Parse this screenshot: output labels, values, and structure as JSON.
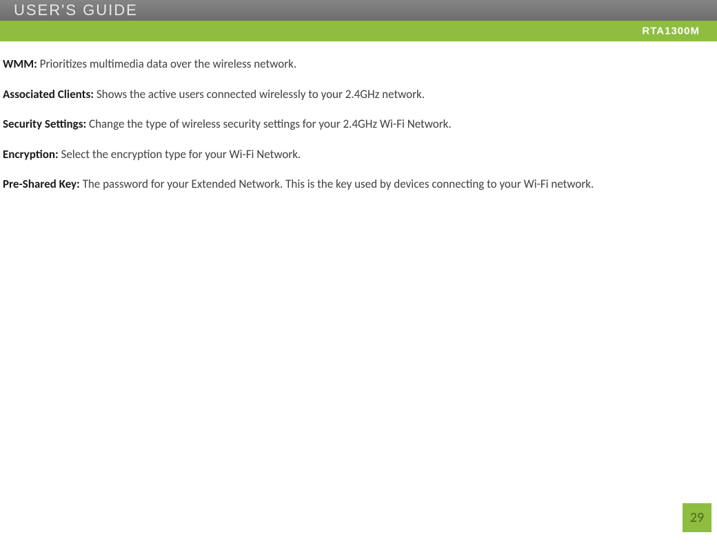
{
  "header": {
    "guide_title": "USER'S GUIDE",
    "model": "RTA1300M"
  },
  "definitions": [
    {
      "term": "WMM:",
      "description": " Prioritizes multimedia data over the wireless network."
    },
    {
      "term": "Associated Clients:",
      "description": " Shows the active users connected wirelessly to your 2.4GHz network."
    },
    {
      "term": "Security Settings:",
      "description": " Change the type of wireless security settings for your 2.4GHz Wi-Fi Network."
    },
    {
      "term": "Encryption:",
      "description": " Select the encryption type for your Wi-Fi Network."
    },
    {
      "term": "Pre-Shared Key:",
      "description": " The password for your Extended Network.  This is the key used by devices connecting to your Wi-Fi network."
    }
  ],
  "page_number": "29"
}
